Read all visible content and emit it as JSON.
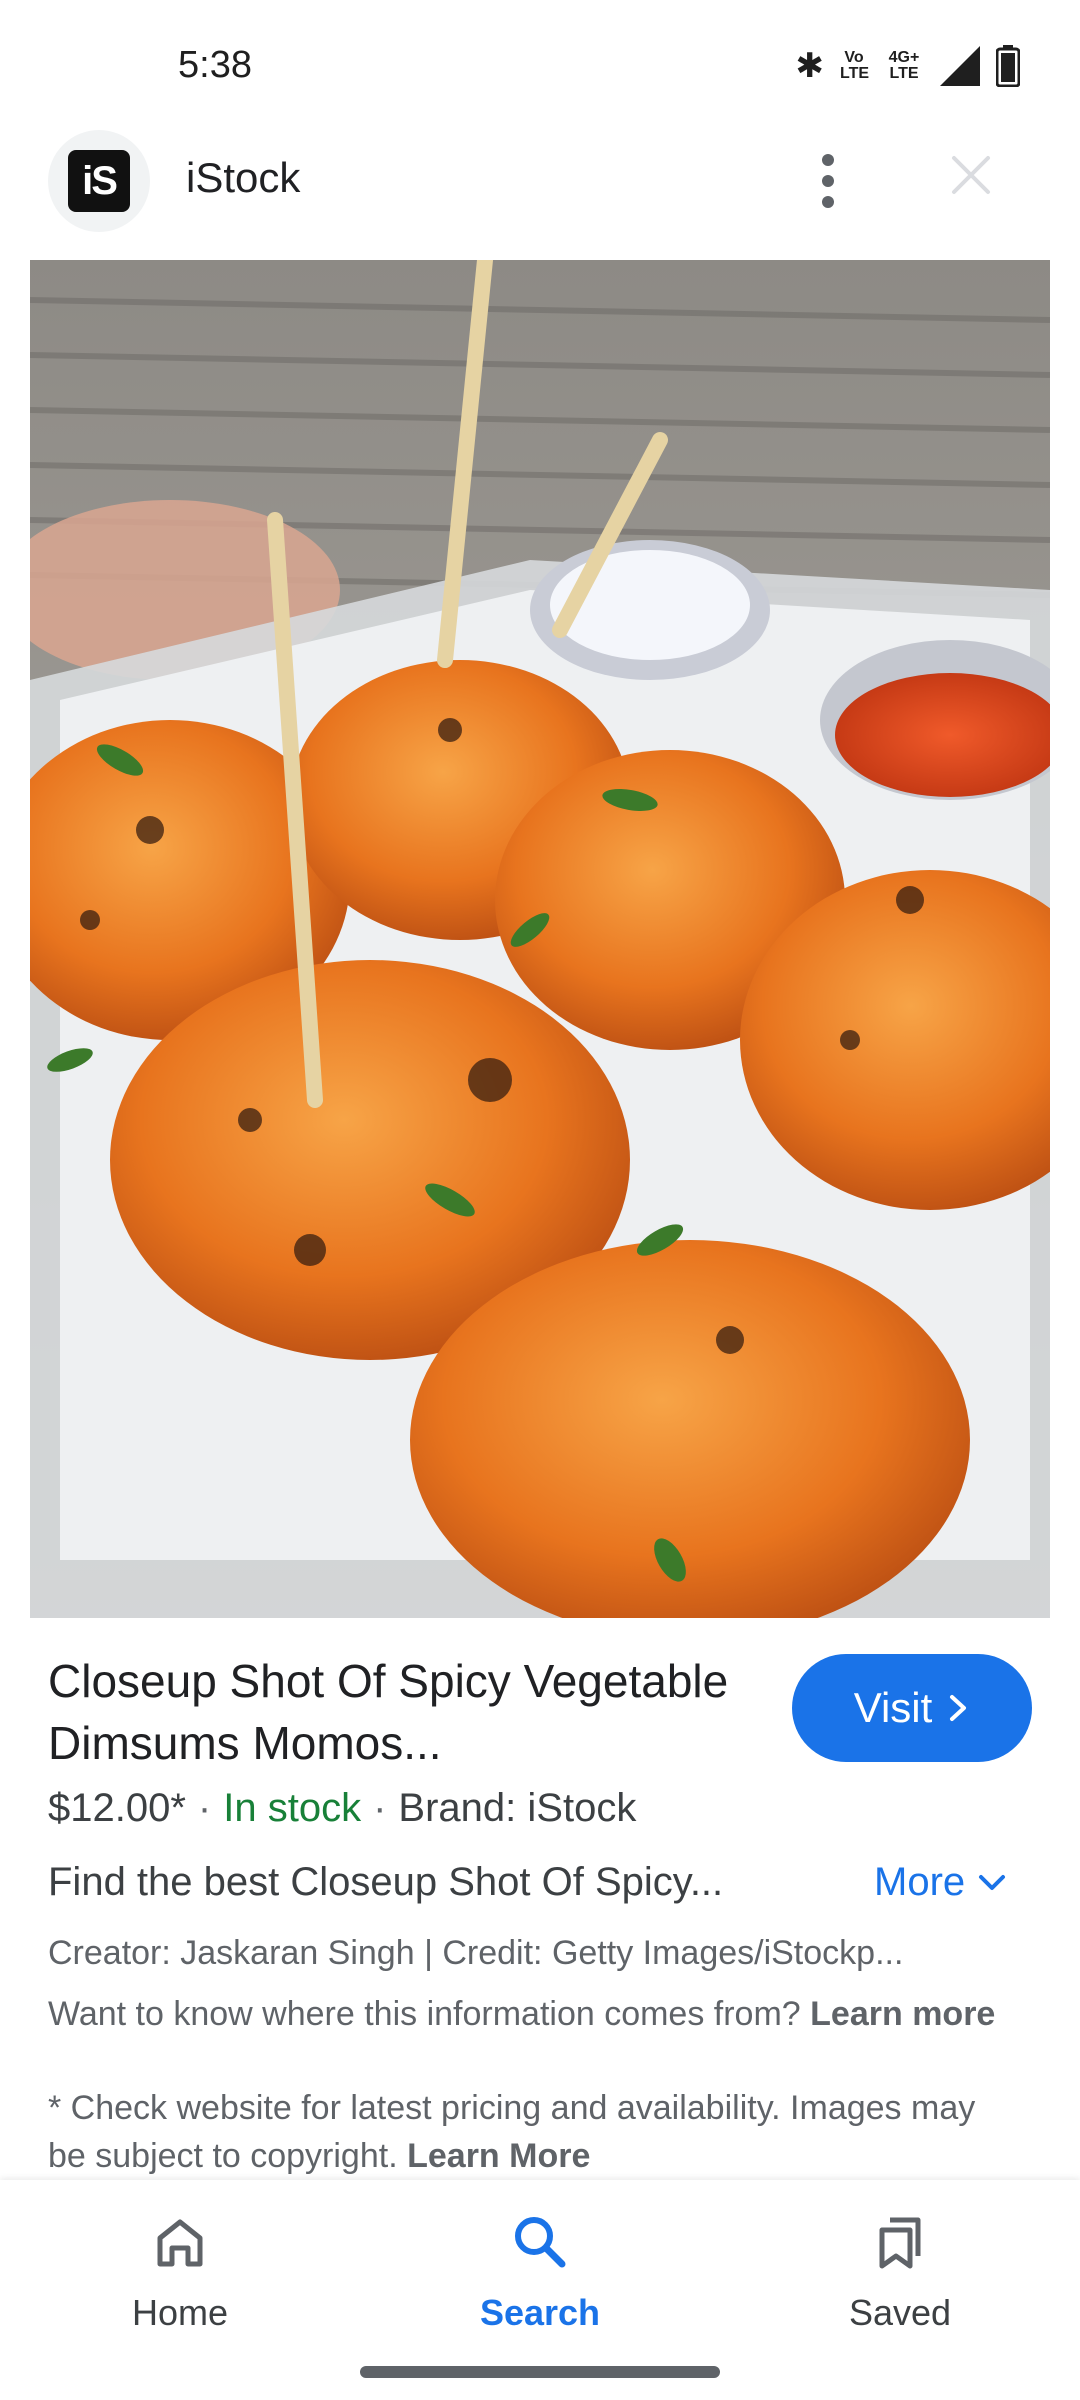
{
  "status_bar": {
    "time": "5:38",
    "volte": "Vo LTE",
    "network": "4G+ LTE"
  },
  "header": {
    "site_logo_text": "iS",
    "site_name": "iStock"
  },
  "product": {
    "title": "Closeup Shot Of Spicy Vegetable Dimsums Momos...",
    "visit_label": "Visit",
    "price": "$12.00*",
    "stock": "In stock",
    "brand": "Brand: iStock",
    "description": "Find the best Closeup Shot Of Spicy...",
    "more_label": "More",
    "credit": "Creator: Jaskaran Singh | Credit: Getty Images/iStockp...",
    "source_question": "Want to know where this information comes from?",
    "learn_more_1": "Learn more",
    "disclaimer": "* Check website for latest pricing and availability. Images may be subject to copyright.",
    "learn_more_2": "Learn More"
  },
  "bottom_nav": {
    "items": [
      {
        "label": "Home",
        "icon": "home-icon"
      },
      {
        "label": "Search",
        "icon": "search-icon",
        "active": true
      },
      {
        "label": "Saved",
        "icon": "bookmarks-icon"
      }
    ]
  },
  "colors": {
    "accent": "#1a73e8",
    "in_stock": "#188038",
    "text": "#202124",
    "secondary_text": "#5f6368"
  }
}
